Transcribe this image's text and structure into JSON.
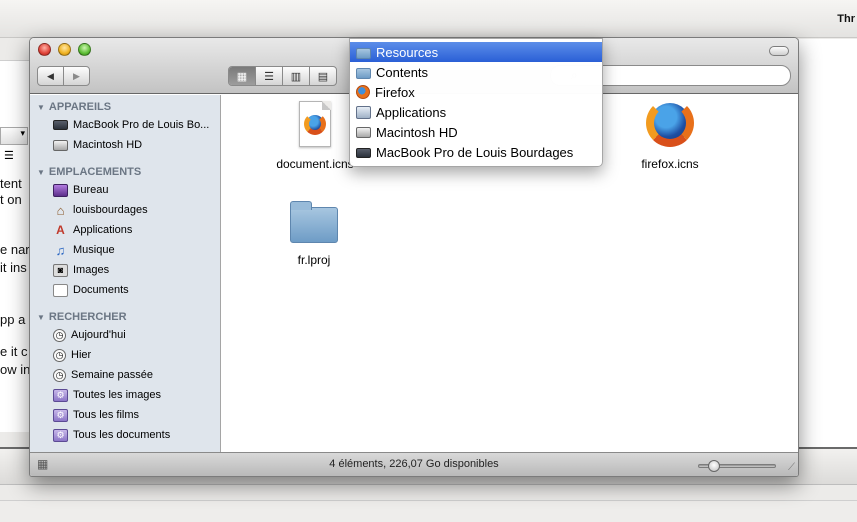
{
  "background": {
    "title_fragment": "Thr",
    "doc_text_lines": [
      "tent",
      "t on",
      "e nar",
      "it ins",
      "pp a",
      "e it c",
      "ow in"
    ]
  },
  "window": {
    "nav": {
      "back_glyph": "◀",
      "forward_glyph": "▶"
    },
    "view_buttons": [
      {
        "name": "icon-view",
        "glyph": "▦"
      },
      {
        "name": "list-view",
        "glyph": "☰"
      },
      {
        "name": "column-view",
        "glyph": "▥"
      },
      {
        "name": "coverflow-view",
        "glyph": "▤"
      }
    ],
    "search": {
      "value": "",
      "icon": "search-icon"
    }
  },
  "sidebar": {
    "sections": [
      {
        "header": "APPAREILS",
        "items": [
          {
            "label": "MacBook Pro de Louis Bo...",
            "icon": "laptop-icon"
          },
          {
            "label": "Macintosh HD",
            "icon": "hard-disk-icon"
          }
        ]
      },
      {
        "header": "EMPLACEMENTS",
        "items": [
          {
            "label": "Bureau",
            "icon": "desktop-icon"
          },
          {
            "label": "louisbourdages",
            "icon": "home-icon"
          },
          {
            "label": "Applications",
            "icon": "applications-icon"
          },
          {
            "label": "Musique",
            "icon": "music-icon"
          },
          {
            "label": "Images",
            "icon": "images-icon"
          },
          {
            "label": "Documents",
            "icon": "documents-icon"
          }
        ]
      },
      {
        "header": "RECHERCHER",
        "items": [
          {
            "label": "Aujourd'hui",
            "icon": "clock-icon"
          },
          {
            "label": "Hier",
            "icon": "clock-icon"
          },
          {
            "label": "Semaine passée",
            "icon": "clock-icon"
          },
          {
            "label": "Toutes les images",
            "icon": "smart-folder-icon"
          },
          {
            "label": "Tous les films",
            "icon": "smart-folder-icon"
          },
          {
            "label": "Tous les documents",
            "icon": "smart-folder-icon"
          }
        ]
      }
    ]
  },
  "files": [
    {
      "name": "document.icns",
      "icon": "icns-document-icon"
    },
    {
      "name": "firefox.icns",
      "icon": "firefox-icon"
    },
    {
      "name": "fr.lproj",
      "icon": "folder-icon"
    }
  ],
  "status": {
    "text": "4 éléments, 226,07 Go disponibles",
    "zoom_level": 0.2
  },
  "path_menu": {
    "items": [
      {
        "label": "Resources",
        "icon": "folder-icon",
        "selected": true
      },
      {
        "label": "Contents",
        "icon": "folder-icon",
        "selected": false
      },
      {
        "label": "Firefox",
        "icon": "firefox-icon",
        "selected": false
      },
      {
        "label": "Applications",
        "icon": "applications-folder-icon",
        "selected": false
      },
      {
        "label": "Macintosh HD",
        "icon": "hard-disk-icon",
        "selected": false
      },
      {
        "label": "MacBook Pro de Louis Bourdages",
        "icon": "laptop-icon",
        "selected": false
      }
    ]
  }
}
